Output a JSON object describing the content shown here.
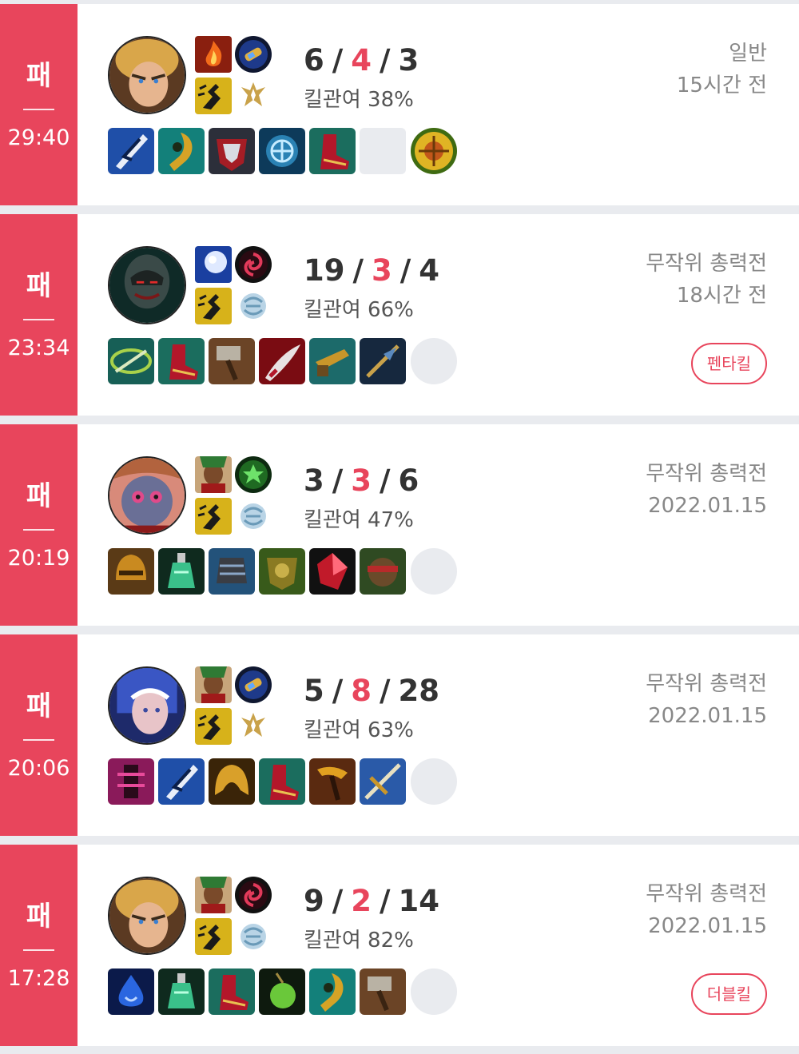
{
  "matches": [
    {
      "result": "패",
      "duration": "29:40",
      "champion_icon": "champion-ezreal-icon",
      "spells": [
        "ignite-icon",
        "teleport-icon"
      ],
      "runes": [
        "phase-rush-icon",
        "precision-rune-icon"
      ],
      "kda": {
        "kills": "6",
        "deaths": "4",
        "assists": "3"
      },
      "kill_participation": "킬관여 38%",
      "queue": "일반",
      "time_ago": "15시간 전",
      "badge": "",
      "items": [
        "item-blue-blade-icon",
        "item-green-gold-icon",
        "item-red-armor-icon",
        "item-teal-rune-icon",
        "item-red-boots-icon",
        "empty-slot"
      ],
      "ward": "oracle-lens-icon"
    },
    {
      "result": "패",
      "duration": "23:34",
      "champion_icon": "champion-pyke-icon",
      "spells": [
        "mark-snowball-icon",
        "flash-swirl-icon"
      ],
      "runes": [
        "phase-rush-icon",
        "sorcery-rune-icon"
      ],
      "kda": {
        "kills": "19",
        "deaths": "3",
        "assists": "4"
      },
      "kill_participation": "킬관여 66%",
      "queue": "무작위 총력전",
      "time_ago": "18시간 전",
      "badge": "펜타킬",
      "items": [
        "item-teal-sword-icon",
        "item-red-boots-icon",
        "item-hammer-icon",
        "item-red-blade-icon",
        "item-gold-gun-icon",
        "item-dark-blade-icon"
      ],
      "ward": "empty"
    },
    {
      "result": "패",
      "duration": "20:19",
      "champion_icon": "champion-vex-icon",
      "spells": [
        "champion-mini-icon",
        "heal-swirl-icon"
      ],
      "runes": [
        "phase-rush-icon",
        "sorcery-rune-icon"
      ],
      "kda": {
        "kills": "3",
        "deaths": "3",
        "assists": "6"
      },
      "kill_participation": "킬관여 47%",
      "queue": "무작위 총력전",
      "time_ago": "2022.01.15",
      "badge": "",
      "items": [
        "item-gold-helm-icon",
        "item-potion-icon",
        "item-grey-glove-icon",
        "item-green-armor-icon",
        "item-red-crystal-icon",
        "item-bear-icon"
      ],
      "ward": "empty"
    },
    {
      "result": "패",
      "duration": "20:06",
      "champion_icon": "champion-ashe-icon",
      "spells": [
        "champion-mini-icon",
        "teleport-icon"
      ],
      "runes": [
        "phase-rush-icon",
        "precision-rune-icon"
      ],
      "kda": {
        "kills": "5",
        "deaths": "8",
        "assists": "28"
      },
      "kill_participation": "킬관여 63%",
      "queue": "무작위 총력전",
      "time_ago": "2022.01.15",
      "badge": "",
      "items": [
        "item-pink-tower-icon",
        "item-blue-blade-icon",
        "item-gold-shield-icon",
        "item-red-boots-icon",
        "item-gold-hammer-icon",
        "item-blue-bow-icon"
      ],
      "ward": "empty"
    },
    {
      "result": "패",
      "duration": "17:28",
      "champion_icon": "champion-ezreal-icon",
      "spells": [
        "champion-mini-icon",
        "flash-swirl-icon"
      ],
      "runes": [
        "phase-rush-icon",
        "sorcery-rune-icon"
      ],
      "kda": {
        "kills": "9",
        "deaths": "2",
        "assists": "14"
      },
      "kill_participation": "킬관여 82%",
      "queue": "무작위 총력전",
      "time_ago": "2022.01.15",
      "badge": "더블킬",
      "items": [
        "item-blue-tear-icon",
        "item-potion-icon",
        "item-red-boots-icon",
        "item-green-orb-icon",
        "item-green-gold-icon",
        "item-hammer-icon"
      ],
      "ward": "empty"
    }
  ],
  "colors": {
    "loss": "#e8455c",
    "text": "#333333",
    "muted": "#888888",
    "divider_bg": "#e9ebef"
  }
}
